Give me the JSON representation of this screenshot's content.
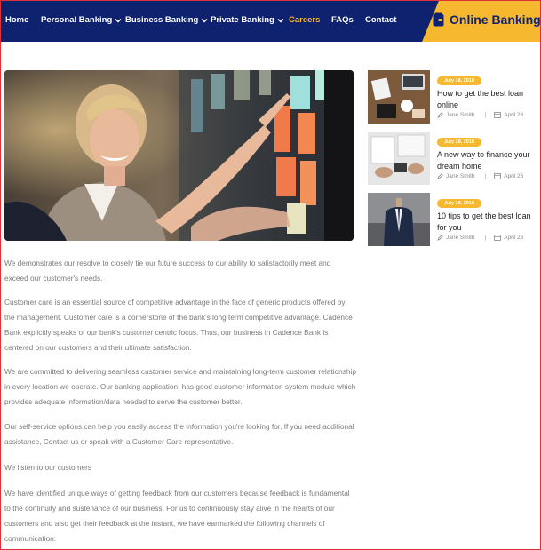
{
  "nav": {
    "items": [
      {
        "label": "Home"
      },
      {
        "label": "Personal Banking"
      },
      {
        "label": "Business Banking"
      },
      {
        "label": "Private Banking"
      },
      {
        "label": "Careers"
      },
      {
        "label": "FAQs"
      },
      {
        "label": "Contact"
      }
    ],
    "online_banking": "Online Banking"
  },
  "article": {
    "paragraphs": [
      "We demonstrates our resolve to closely tie our future success to our ability to satisfactorily meet and exceed our customer's needs.",
      "Customer care is an essential source of competitive advantage in the face of generic products offered by the management. Customer care is a cornerstone of the bank's long term competitive advantage. Cadence Bank explicitly speaks of our bank's customer centric focus. Thus, our business in Cadence Bank is centered on our customers and their ultimate satisfaction.",
      "We are committed to delivering seamless customer service and maintaining long-term customer relationship in every location we operate. Our banking application, has good customer information system module which provides adequate information/data needed to serve the customer better.",
      "Our self-service options can help you easily access the information you're looking for. If you need additional assistance, Contact us or speak with a Customer Care representative.",
      "We listen to our customers",
      "We have identified unique ways of getting feedback from our customers because feedback is fundamental to the continuity and sustenance of our business. For us to continuously stay alive in the hearts of our customers and also get their feedback at the instant, we have earmarked the following channels of communication:"
    ]
  },
  "posts": [
    {
      "date": "July 18, 2018",
      "title": "How to get the best loan online",
      "author": "Jane Smith",
      "day": "April 26"
    },
    {
      "date": "July 18, 2018",
      "title": "A new way to finance your dream home",
      "author": "Jane Smith",
      "day": "April 26"
    },
    {
      "date": "July 18, 2018",
      "title": "10 tips to get the best loan for you",
      "author": "Jane Smith",
      "day": "April 26"
    }
  ],
  "colors": {
    "nav": "#0f2270",
    "accent": "#f5b82e",
    "text": "#7a7a7a"
  },
  "icons": [
    "chevron-down-icon",
    "wallet-icon",
    "pencil-icon",
    "calendar-icon"
  ]
}
